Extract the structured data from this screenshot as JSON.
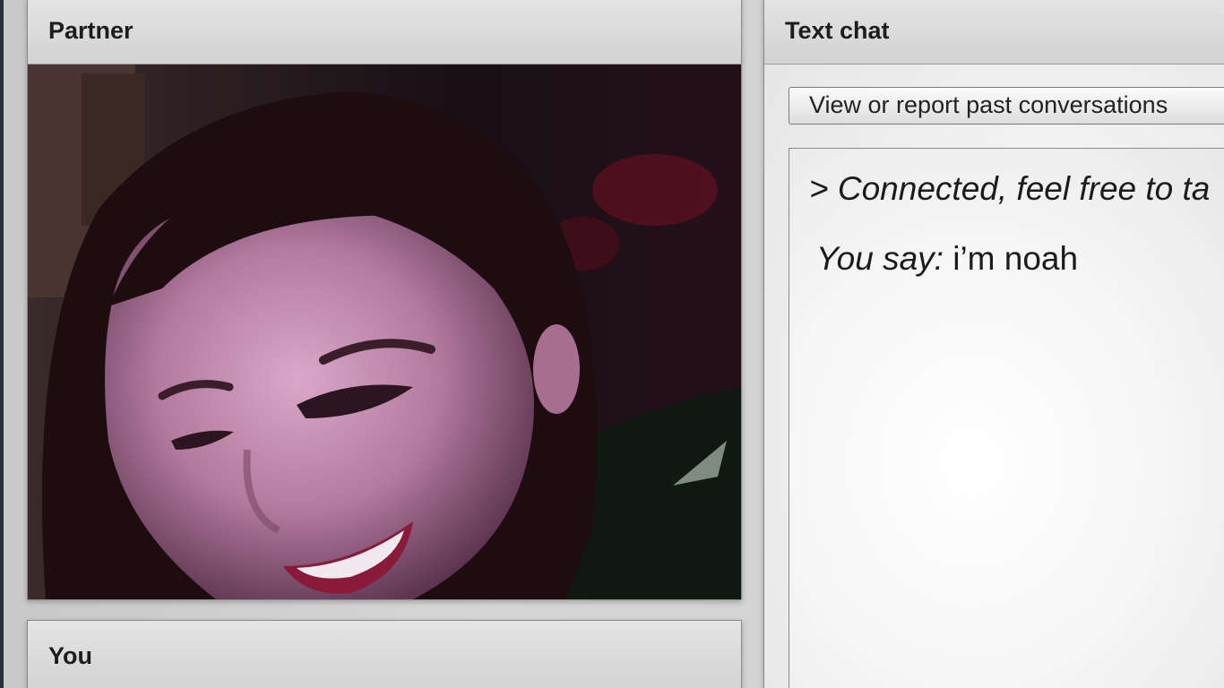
{
  "partner_panel": {
    "title": "Partner",
    "video": "partner-webcam-video"
  },
  "you_panel": {
    "title": "You"
  },
  "chat_panel": {
    "title": "Text chat",
    "report_button_label": "View or report past conversations",
    "status_message": "> Connected, feel free to ta",
    "messages": [
      {
        "speaker": "You say:",
        "text": "i’m noah"
      }
    ]
  }
}
